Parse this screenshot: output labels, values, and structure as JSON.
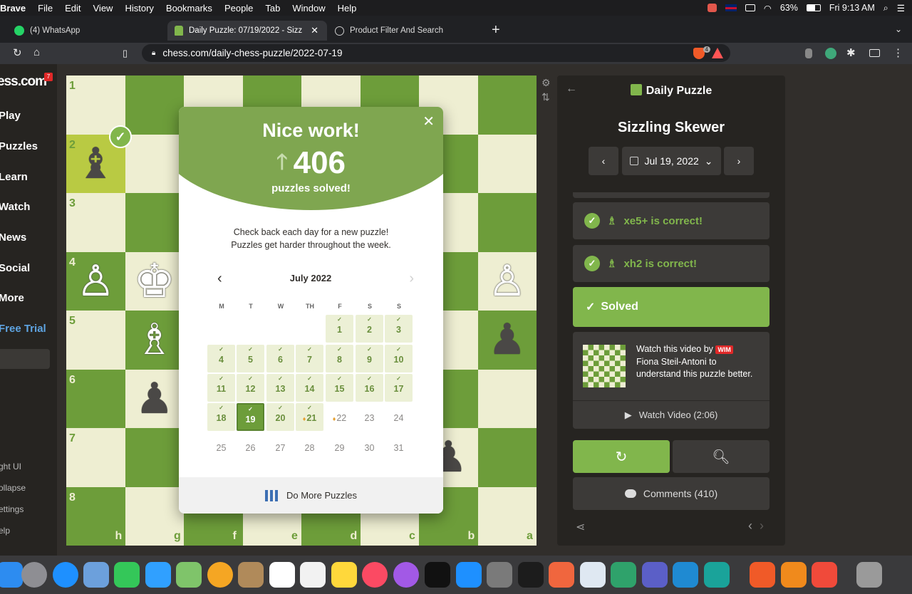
{
  "menubar": {
    "app": "Brave",
    "items": [
      "File",
      "Edit",
      "View",
      "History",
      "Bookmarks",
      "People",
      "Tab",
      "Window",
      "Help"
    ],
    "battery": "63%",
    "clock": "Fri 9:13 AM"
  },
  "tabs": [
    {
      "label": "(4) WhatsApp"
    },
    {
      "label": "Daily Puzzle: 07/19/2022 - Sizz"
    },
    {
      "label": "Product Filter And Search"
    }
  ],
  "address": {
    "url": "chess.com/daily-chess-puzzle/2022-07-19",
    "shield_count": "4"
  },
  "sidebar": {
    "logo": "ess.com",
    "logo_badge": "7",
    "nav": [
      "Play",
      "Puzzles",
      "Learn",
      "Watch",
      "News",
      "Social",
      "More",
      "Free Trial"
    ],
    "footer": [
      "ght UI",
      "ollapse",
      "ettings",
      "elp"
    ]
  },
  "board": {
    "ranks": [
      "1",
      "2",
      "3",
      "4",
      "5",
      "6",
      "7",
      "8"
    ],
    "files": [
      "h",
      "g",
      "f",
      "e",
      "d",
      "c",
      "b",
      "a"
    ]
  },
  "modal": {
    "title": "Nice work!",
    "count": "406",
    "count_label": "puzzles solved!",
    "message_line1": "Check back each day for a new puzzle!",
    "message_line2": "Puzzles get harder throughout the week.",
    "month": "July 2022",
    "weekdays": [
      "M",
      "T",
      "W",
      "TH",
      "F",
      "S",
      "S"
    ],
    "days": [
      "1",
      "2",
      "3",
      "4",
      "5",
      "6",
      "7",
      "8",
      "9",
      "10",
      "11",
      "12",
      "13",
      "14",
      "15",
      "16",
      "17",
      "18",
      "19",
      "20",
      "21",
      "22",
      "23",
      "24",
      "25",
      "26",
      "27",
      "28",
      "29",
      "30",
      "31"
    ],
    "footer_label": "Do More Puzzles"
  },
  "panel": {
    "header": "Daily Puzzle",
    "puzzle_name": "Sizzling Skewer",
    "date": "Jul 19, 2022",
    "moves": [
      {
        "text": "xe5+ is correct!"
      },
      {
        "text": "xh2 is correct!"
      }
    ],
    "solved": "Solved",
    "video_text_pre": "Watch this video by",
    "video_badge": "WIM",
    "video_text_post": "Fiona Steil-Antoni to understand this puzzle better.",
    "watch_label": "Watch Video (2:06)",
    "comments": "Comments (410)"
  },
  "colors": {
    "board_light": "#eeeed2",
    "board_dark": "#6d9d3a",
    "accent": "#81b64c"
  }
}
